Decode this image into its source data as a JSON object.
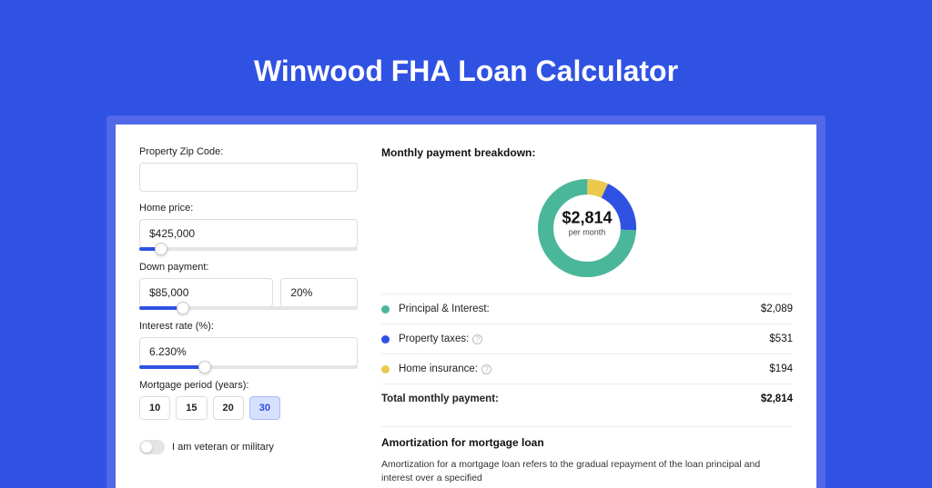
{
  "title": "Winwood FHA Loan Calculator",
  "form": {
    "zip_label": "Property Zip Code:",
    "zip_value": "",
    "home_price_label": "Home price:",
    "home_price_value": "$425,000",
    "down_payment_label": "Down payment:",
    "down_payment_value": "$85,000",
    "down_payment_pct": "20%",
    "interest_rate_label": "Interest rate (%):",
    "interest_rate_value": "6.230%",
    "mortgage_period_label": "Mortgage period (years):",
    "periods": [
      {
        "label": "10",
        "active": false
      },
      {
        "label": "15",
        "active": false
      },
      {
        "label": "20",
        "active": false
      },
      {
        "label": "30",
        "active": true
      }
    ],
    "veteran_label": "I am veteran or military",
    "veteran_value": false
  },
  "breakdown": {
    "title": "Monthly payment breakdown:",
    "center_amount": "$2,814",
    "center_sub": "per month",
    "items": [
      {
        "name": "Principal & Interest:",
        "value": "$2,089",
        "color": "green",
        "info": false
      },
      {
        "name": "Property taxes:",
        "value": "$531",
        "color": "blue",
        "info": true
      },
      {
        "name": "Home insurance:",
        "value": "$194",
        "color": "yellow",
        "info": true
      }
    ],
    "total_label": "Total monthly payment:",
    "total_value": "$2,814"
  },
  "amortization": {
    "title": "Amortization for mortgage loan",
    "text": "Amortization for a mortgage loan refers to the gradual repayment of the loan principal and interest over a specified"
  },
  "colors": {
    "green": "#4bb79a",
    "blue": "#3052e3",
    "yellow": "#eac94d"
  },
  "chart_data": {
    "type": "pie",
    "title": "Monthly payment breakdown",
    "categories": [
      "Principal & Interest",
      "Property taxes",
      "Home insurance"
    ],
    "values": [
      2089,
      531,
      194
    ],
    "total": 2814,
    "colors": [
      "#4bb79a",
      "#3052e3",
      "#eac94d"
    ],
    "center_label": "$2,814 per month"
  }
}
